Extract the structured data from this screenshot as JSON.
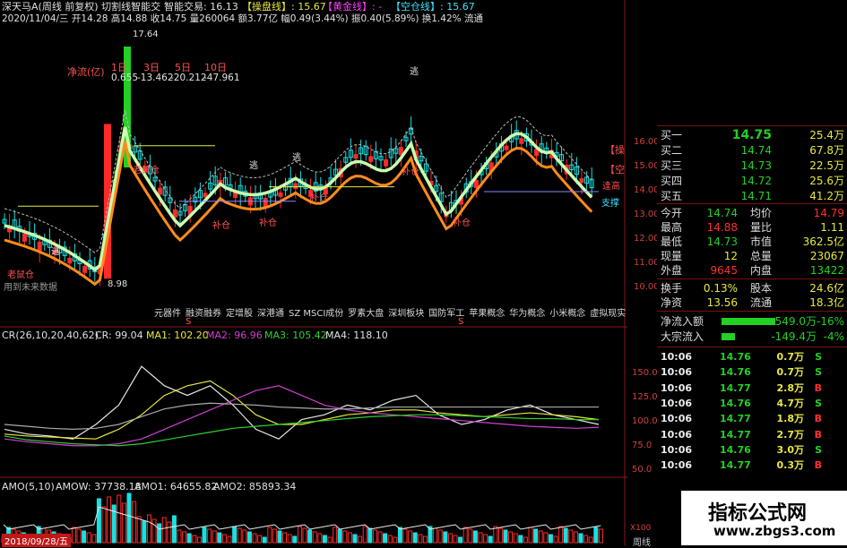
{
  "header": {
    "line1_left": "深天马A(周线 前复权) 切割线智能交",
    "line1_mid": "智能交易: 16.13",
    "tag1": "【操盘线】: 15.67",
    "tag2": "【黄金线】: -",
    "tag3": "【空仓线】: 15.67",
    "line2": "2020/11/04/三 开14.28 高14.88 收14.75 量260064 额3.77亿 幅0.49(3.44%) 振0.40(5.89%) 换1.42% 流通"
  },
  "main": {
    "top_price_label": "17.64",
    "net_flow_label": "净流(亿)",
    "periods": [
      "1日",
      "3日",
      "5日",
      "10日"
    ],
    "period_values": [
      "0.655",
      "-13.462",
      "-20.212",
      "-47.961"
    ],
    "low_price_label": "8.98",
    "labels": {
      "escape": "逃",
      "bottom": "抄底",
      "old_cat": "老鼠仓",
      "old_cat2": "老鼠仓",
      "supplement": "补仓",
      "support": "支撑",
      "right_tag1": "【操",
      "right_tag2": "【空",
      "right_tag3": "逢高"
    },
    "no_data": "用到未来数据",
    "y_axis": [
      "16.00",
      "15.00",
      "14.00",
      "13.00",
      "12.00",
      "11.00",
      "10.00"
    ],
    "concepts": [
      "元器件",
      "融资融券",
      "定增股",
      "深港通",
      "SZ MSCI成份",
      "罗素大盘",
      "深圳板块",
      "国防军工",
      "苹果概念",
      "华为概念",
      "小米概念",
      "虚拟现实"
    ],
    "markers": [
      "S",
      "S"
    ],
    "colors": {
      "up": "#ff2a2a",
      "down": "#19e0e0",
      "green": "#23d023",
      "orange": "#ff8c1a",
      "cyan_line": "#80ffd0"
    }
  },
  "cr": {
    "title": "CR(26,10,20,40,62)",
    "cr_label": "CR: 99.04",
    "ma1": "MA1: 102.20",
    "ma2": "MA2: 96.96",
    "ma3": "MA3: 105.42",
    "ma4": "MA4: 118.10",
    "y_axis": [
      "150.0",
      "125.0",
      "100.0",
      "75.0",
      "50.0"
    ],
    "colors": {
      "cr": "#e8e8e8",
      "ma1": "#e8e840",
      "ma2": "#d040d0",
      "ma3": "#30d030",
      "ma4": "#e8e8e8"
    }
  },
  "amo": {
    "title": "AMO(5,10)",
    "amow": "AMOW: 37738.18",
    "amo1": "AMO1: 64655.82",
    "amo2": "AMO2: 85893.34",
    "x100": "X100",
    "date": "2018/09/28/五",
    "week": "周线"
  },
  "quote": {
    "bids": [
      {
        "label": "买一",
        "price": "14.75",
        "vol": "25.4万"
      },
      {
        "label": "买二",
        "price": "14.74",
        "vol": "67.8万"
      },
      {
        "label": "买三",
        "price": "14.73",
        "vol": "22.5万"
      },
      {
        "label": "买四",
        "price": "14.72",
        "vol": "25.6万"
      },
      {
        "label": "买五",
        "price": "14.71",
        "vol": "41.2万"
      }
    ],
    "stats": [
      {
        "l1": "今开",
        "v1": "14.74",
        "l2": "均价",
        "v2": "14.79"
      },
      {
        "l1": "最高",
        "v1": "14.88",
        "l2": "量比",
        "v2": "1.11"
      },
      {
        "l1": "最低",
        "v1": "14.73",
        "l2": "市值",
        "v2": "362.5亿"
      },
      {
        "l1": "现量",
        "v1": "12",
        "l2": "总量",
        "v2": "23067"
      },
      {
        "l1": "外盘",
        "v1": "9645",
        "l2": "内盘",
        "v2": "13422"
      }
    ],
    "stats2": [
      {
        "l1": "换手",
        "v1": "0.13%",
        "l2": "股本",
        "v2": "24.6亿"
      },
      {
        "l1": "净资",
        "v1": "13.56",
        "l2": "流通",
        "v2": "18.3亿"
      }
    ],
    "flows": [
      {
        "label": "净流入额",
        "value": "-549.0万",
        "pct": "-16%",
        "fill": 0.85
      },
      {
        "label": "大宗流入",
        "value": "-149.4万",
        "pct": "-4%",
        "fill": 0.22
      }
    ],
    "ticks": [
      {
        "time": "10:06",
        "price": "14.76",
        "vol": "0.7万",
        "side": "S"
      },
      {
        "time": "10:06",
        "price": "14.76",
        "vol": "0.7万",
        "side": "S"
      },
      {
        "time": "10:06",
        "price": "14.77",
        "vol": "2.8万",
        "side": "B"
      },
      {
        "time": "10:06",
        "price": "14.76",
        "vol": "4.7万",
        "side": "S"
      },
      {
        "time": "10:06",
        "price": "14.77",
        "vol": "1.8万",
        "side": "B"
      },
      {
        "time": "10:06",
        "price": "14.77",
        "vol": "2.7万",
        "side": "B"
      },
      {
        "time": "10:06",
        "price": "14.76",
        "vol": "3.0万",
        "side": "S"
      },
      {
        "time": "10:06",
        "price": "14.77",
        "vol": "0.3万",
        "side": "B"
      }
    ]
  },
  "watermark": {
    "title": "指标公式网",
    "url": "www.zbgs3.com"
  }
}
